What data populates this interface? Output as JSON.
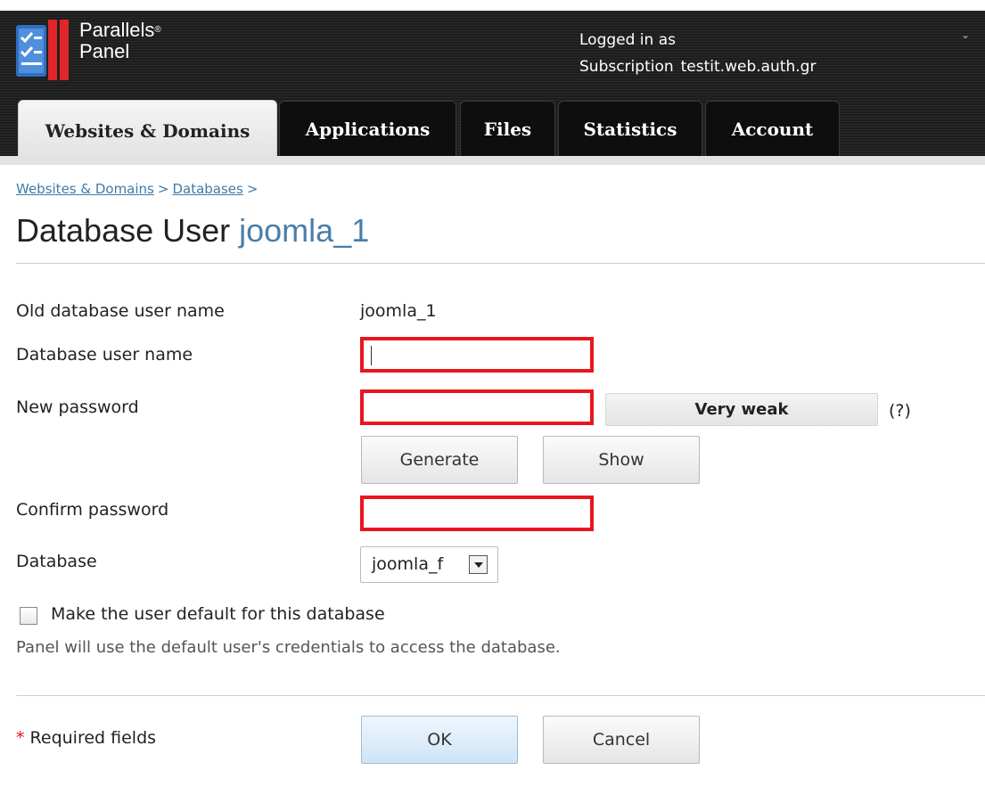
{
  "header": {
    "logo_text_line1": "Parallels",
    "logo_reg": "®",
    "logo_text_line2": "Panel",
    "logged_in_as": "Logged in as",
    "subscription_label": "Subscription",
    "subscription_value": "testit.web.auth.gr",
    "menu_chevron": "⌄"
  },
  "tabs": [
    {
      "label": "Websites & Domains",
      "active": true
    },
    {
      "label": "Applications",
      "active": false
    },
    {
      "label": "Files",
      "active": false
    },
    {
      "label": "Statistics",
      "active": false
    },
    {
      "label": "Account",
      "active": false
    }
  ],
  "breadcrumb": {
    "items": [
      "Websites & Domains",
      "Databases"
    ],
    "separator": ">"
  },
  "page": {
    "title_prefix": "Database User",
    "title_object": "joomla_1"
  },
  "form": {
    "old_name_label": "Old database user name",
    "old_name_value": "joomla_1",
    "user_name_label": "Database user name",
    "user_name_value": "",
    "new_password_label": "New password",
    "password_strength": "Very weak",
    "help_link": "(?)",
    "generate_label": "Generate",
    "show_label": "Show",
    "confirm_password_label": "Confirm password",
    "database_label": "Database",
    "database_selected": "joomla_f",
    "default_user_label": "Make the user default for this database",
    "default_user_checked": false,
    "default_user_hint": "Panel will use the default user's credentials to access the database.",
    "required_star": "*",
    "required_label": "Required fields",
    "ok_label": "OK",
    "cancel_label": "Cancel"
  },
  "colors": {
    "highlight": "#e8161f",
    "link": "#3f7aa6",
    "header_bg": "#1d1d1d"
  }
}
